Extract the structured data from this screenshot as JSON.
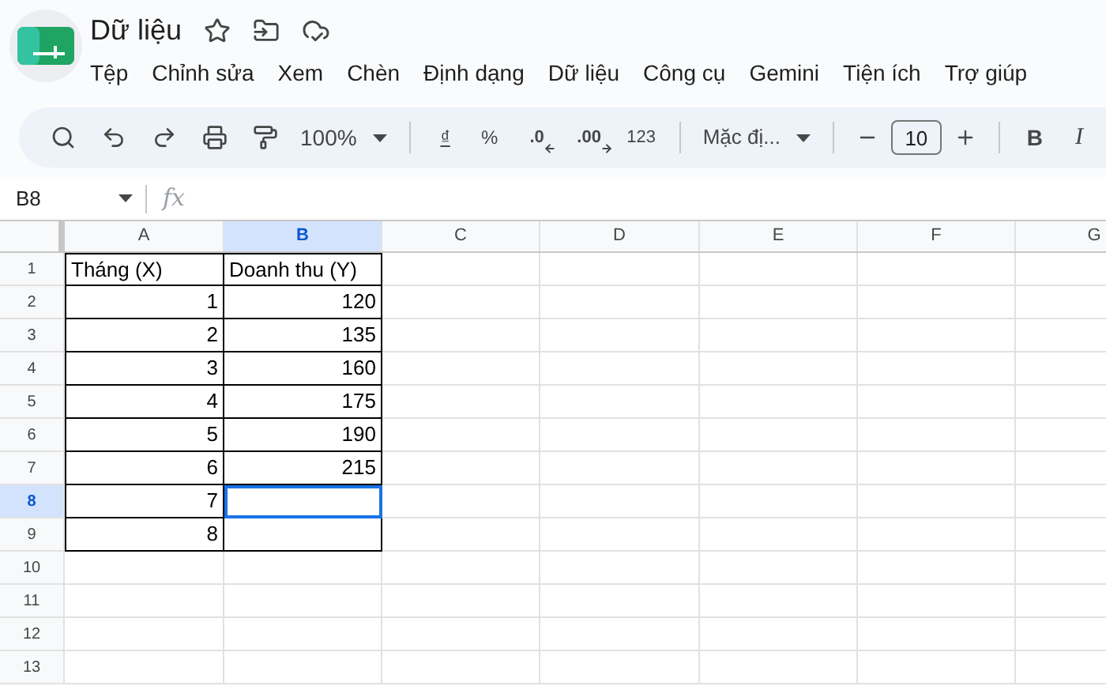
{
  "document": {
    "title": "Dữ liệu"
  },
  "menu": [
    "Tệp",
    "Chỉnh sửa",
    "Xem",
    "Chèn",
    "Định dạng",
    "Dữ liệu",
    "Công cụ",
    "Gemini",
    "Tiện ích",
    "Trợ giúp"
  ],
  "toolbar": {
    "zoom": "100%",
    "currency": "₫",
    "percent": "%",
    "decrease_decimals": ".0",
    "increase_decimals": ".00",
    "number_format": "123",
    "font": "Mặc đị...",
    "font_size": "10",
    "bold": "B",
    "italic": "I"
  },
  "formula_bar": {
    "cell_ref": "B8",
    "fx": "fx"
  },
  "columns": [
    {
      "label": "A",
      "selected": false
    },
    {
      "label": "B",
      "selected": true
    },
    {
      "label": "C",
      "selected": false
    },
    {
      "label": "D",
      "selected": false
    },
    {
      "label": "E",
      "selected": false
    },
    {
      "label": "F",
      "selected": false
    },
    {
      "label": "G",
      "selected": false
    }
  ],
  "rows": [
    {
      "label": "1",
      "selected": false,
      "bordered": true,
      "cells": [
        {
          "kind": "text",
          "value": "Tháng (X)"
        },
        {
          "kind": "text",
          "value": "Doanh thu (Y)"
        }
      ]
    },
    {
      "label": "2",
      "selected": false,
      "bordered": true,
      "cells": [
        {
          "kind": "number",
          "value": "1"
        },
        {
          "kind": "number",
          "value": "120"
        }
      ]
    },
    {
      "label": "3",
      "selected": false,
      "bordered": true,
      "cells": [
        {
          "kind": "number",
          "value": "2"
        },
        {
          "kind": "number",
          "value": "135"
        }
      ]
    },
    {
      "label": "4",
      "selected": false,
      "bordered": true,
      "cells": [
        {
          "kind": "number",
          "value": "3"
        },
        {
          "kind": "number",
          "value": "160"
        }
      ]
    },
    {
      "label": "5",
      "selected": false,
      "bordered": true,
      "cells": [
        {
          "kind": "number",
          "value": "4"
        },
        {
          "kind": "number",
          "value": "175"
        }
      ]
    },
    {
      "label": "6",
      "selected": false,
      "bordered": true,
      "cells": [
        {
          "kind": "number",
          "value": "5"
        },
        {
          "kind": "number",
          "value": "190"
        }
      ]
    },
    {
      "label": "7",
      "selected": false,
      "bordered": true,
      "cells": [
        {
          "kind": "number",
          "value": "6"
        },
        {
          "kind": "number",
          "value": "215"
        }
      ]
    },
    {
      "label": "8",
      "selected": true,
      "bordered": true,
      "cells": [
        {
          "kind": "number",
          "value": "7"
        },
        {
          "kind": "empty"
        }
      ]
    },
    {
      "label": "9",
      "selected": false,
      "bordered": true,
      "cells": [
        {
          "kind": "number",
          "value": "8"
        },
        {
          "kind": "empty"
        }
      ]
    },
    {
      "label": "10",
      "selected": false,
      "bordered": false
    },
    {
      "label": "11",
      "selected": false,
      "bordered": false
    },
    {
      "label": "12",
      "selected": false,
      "bordered": false
    },
    {
      "label": "13",
      "selected": false,
      "bordered": false
    }
  ]
}
